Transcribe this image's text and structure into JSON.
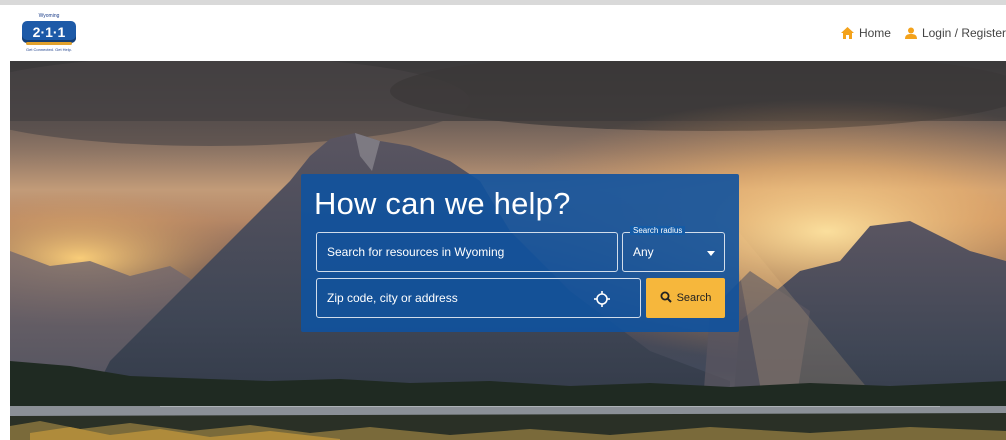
{
  "brand": {
    "logo_top": "Wyoming",
    "logo_number": "2·1·1",
    "logo_tagline": "Get Connected. Get Help.",
    "logo_colors": {
      "badge": "#1d5aa8",
      "swoosh": "#e2a12c"
    }
  },
  "nav": {
    "home_label": "Home",
    "login_label": "Login / Register",
    "icon_color": "#f3a21b"
  },
  "hero": {
    "image_description": "mountain-sunset-landscape"
  },
  "search_panel": {
    "title": "How can we help?",
    "search_placeholder": "Search for resources in Wyoming",
    "radius_label": "Search radius",
    "radius_value": "Any",
    "location_placeholder": "Zip code, city or address",
    "search_button_label": "Search",
    "panel_color": "#10529e",
    "button_color": "#f6b73c"
  }
}
